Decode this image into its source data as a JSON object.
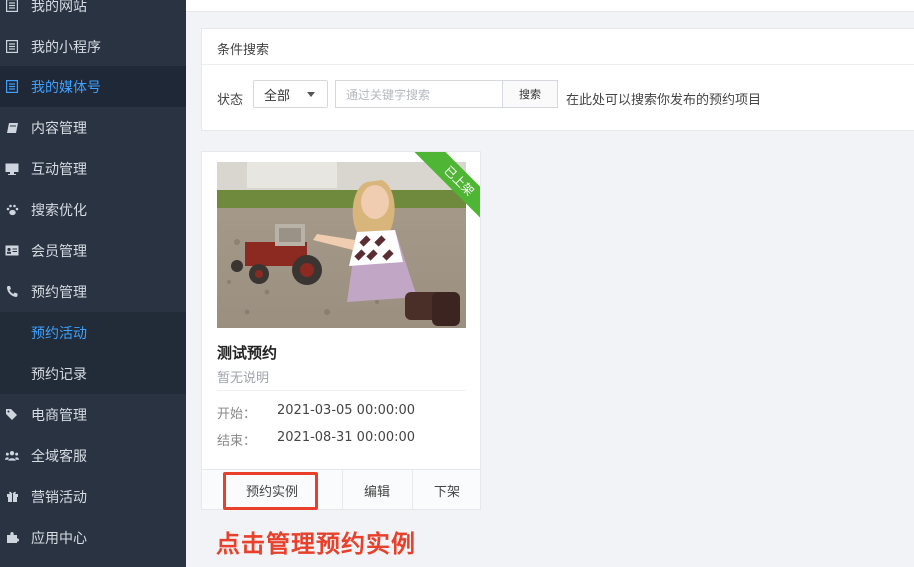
{
  "sidebar": {
    "items": [
      {
        "label": "我的网站",
        "icon": "list-icon"
      },
      {
        "label": "我的小程序",
        "icon": "list-icon"
      },
      {
        "label": "我的媒体号",
        "icon": "list-icon"
      },
      {
        "label": "内容管理",
        "icon": "book-icon"
      },
      {
        "label": "互动管理",
        "icon": "monitor-icon"
      },
      {
        "label": "搜索优化",
        "icon": "paw-icon"
      },
      {
        "label": "会员管理",
        "icon": "id-card-icon"
      },
      {
        "label": "预约管理",
        "icon": "phone-icon"
      },
      {
        "label": "预约活动",
        "icon": ""
      },
      {
        "label": "预约记录",
        "icon": ""
      },
      {
        "label": "电商管理",
        "icon": "tags-icon"
      },
      {
        "label": "全域客服",
        "icon": "users-icon"
      },
      {
        "label": "营销活动",
        "icon": "gift-icon"
      },
      {
        "label": "应用中心",
        "icon": "puzzle-icon"
      }
    ]
  },
  "search": {
    "title": "条件搜索",
    "status_label": "状态",
    "status_selected": "全部",
    "placeholder": "通过关键字搜索",
    "button_label": "搜索",
    "hint": "在此处可以搜索你发布的预约项目"
  },
  "card": {
    "ribbon": "已上架",
    "title": "测试预约",
    "description": "暂无说明",
    "start_label": "开始：",
    "start_value": "2021-03-05 00:00:00",
    "end_label": "结束：",
    "end_value": "2021-08-31 00:00:00",
    "actions": {
      "instances": "预约实例",
      "edit": "编辑",
      "unlist": "下架"
    }
  },
  "annotation": "点击管理预约实例",
  "colors": {
    "sidebar_bg": "#2a3342",
    "accent_blue": "#3fa0ff",
    "ribbon_green": "#4fb534",
    "annotation_red": "#e8402a"
  }
}
